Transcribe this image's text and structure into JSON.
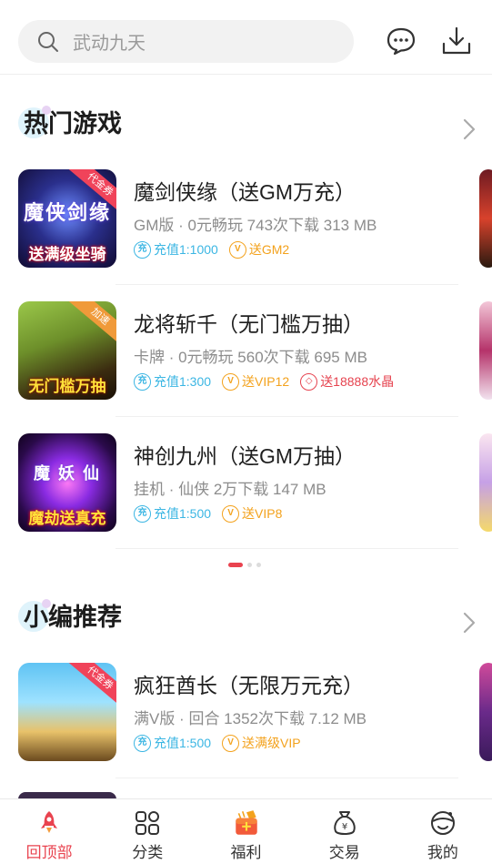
{
  "search": {
    "placeholder": "武动九天"
  },
  "sections": [
    {
      "title": "热门游戏"
    },
    {
      "title": "小编推荐"
    }
  ],
  "games": [
    {
      "name": "魔剑侠缘（送GM万充）",
      "meta": "GM版 · 0元畅玩  743次下载  313 MB",
      "ribbon": "代金券",
      "thumb_caption": "送满级坐骑",
      "thumb_title": "魔侠剑缘",
      "tags": [
        {
          "icon": "充",
          "text": "充值1:1000",
          "color": "blue"
        },
        {
          "icon": "V",
          "text": "送GM2",
          "color": "gold"
        }
      ]
    },
    {
      "name": "龙将斩千（无门槛万抽）",
      "meta": "卡牌 · 0元畅玩  560次下载  695 MB",
      "ribbon": "加速",
      "thumb_caption": "无门槛万抽",
      "thumb_title": "",
      "tags": [
        {
          "icon": "充",
          "text": "充值1:300",
          "color": "blue"
        },
        {
          "icon": "V",
          "text": "送VIP12",
          "color": "gold"
        },
        {
          "icon": "◇",
          "text": "送18888水晶",
          "color": "red"
        }
      ]
    },
    {
      "name": "神创九州（送GM万抽）",
      "meta": "挂机 · 仙侠  2万下载  147 MB",
      "ribbon": "",
      "thumb_caption": "魔劫送真充",
      "thumb_title": "魔 妖 仙",
      "tags": [
        {
          "icon": "充",
          "text": "充值1:500",
          "color": "blue"
        },
        {
          "icon": "V",
          "text": "送VIP8",
          "color": "gold"
        }
      ]
    },
    {
      "name": "疯狂酋长（无限万元充）",
      "meta": "满V版 · 回合  1352次下载  7.12 MB",
      "ribbon": "代金券",
      "thumb_caption": "",
      "thumb_title": "",
      "tags": [
        {
          "icon": "充",
          "text": "充值1:500",
          "color": "blue"
        },
        {
          "icon": "V",
          "text": "送满级VIP",
          "color": "gold"
        }
      ]
    }
  ],
  "nav": [
    {
      "label": "回顶部",
      "icon": "rocket-icon",
      "active": true
    },
    {
      "label": "分类",
      "icon": "grid-icon",
      "active": false
    },
    {
      "label": "福利",
      "icon": "gift-icon",
      "active": false
    },
    {
      "label": "交易",
      "icon": "money-bag-icon",
      "active": false
    },
    {
      "label": "我的",
      "icon": "profile-icon",
      "active": false
    }
  ],
  "colors": {
    "accent": "#e9434f",
    "blue": "#3bb6e3",
    "gold": "#f3a21d"
  }
}
